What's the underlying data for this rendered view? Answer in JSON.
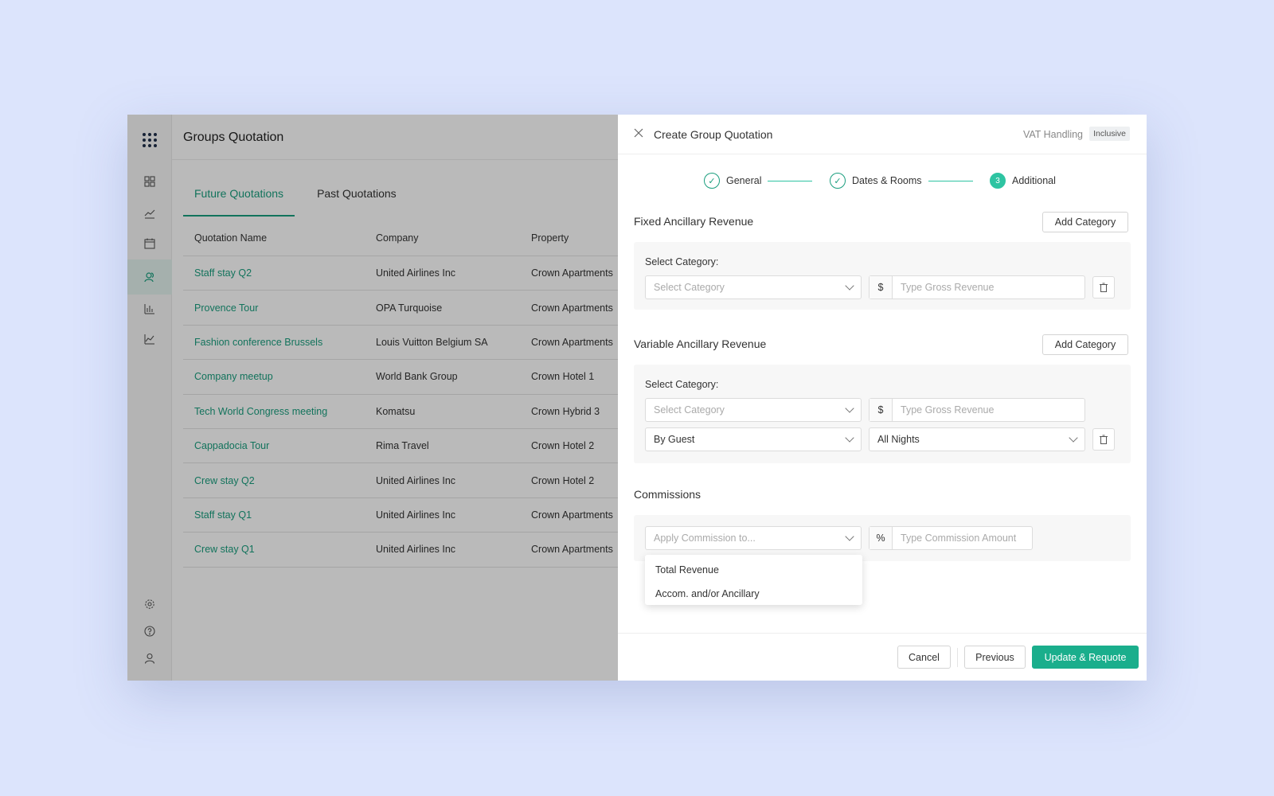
{
  "app": {
    "title": "Groups Quotation"
  },
  "tabs": [
    {
      "label": "Future Quotations",
      "active": true
    },
    {
      "label": "Past Quotations",
      "active": false
    }
  ],
  "table": {
    "headers": [
      "Quotation Name",
      "Company",
      "Property"
    ],
    "rows": [
      [
        "Staff stay Q2",
        "United Airlines Inc",
        "Crown Apartments"
      ],
      [
        "Provence Tour",
        "OPA Turquoise",
        "Crown Apartments"
      ],
      [
        "Fashion conference Brussels",
        "Louis Vuitton Belgium SA",
        "Crown Apartments"
      ],
      [
        "Company meetup",
        "World Bank Group",
        "Crown Hotel 1"
      ],
      [
        "Tech World Congress meeting",
        "Komatsu",
        "Crown Hybrid 3"
      ],
      [
        "Cappadocia Tour",
        "Rima Travel",
        "Crown Hotel 2"
      ],
      [
        "Crew stay Q2",
        "United Airlines Inc",
        "Crown Hotel 2"
      ],
      [
        "Staff stay Q1",
        "United Airlines Inc",
        "Crown Apartments"
      ],
      [
        "Crew stay Q1",
        "United Airlines Inc",
        "Crown Apartments"
      ]
    ]
  },
  "sidebar": {
    "icons": [
      "dashboard-icon",
      "trend-icon",
      "calendar-icon",
      "groups-icon",
      "bar-chart-icon",
      "line-chart-icon"
    ],
    "bottom_icons": [
      "settings-icon",
      "help-icon",
      "user-icon"
    ],
    "active_index": 3
  },
  "modal": {
    "title": "Create Group Quotation",
    "vat_label": "VAT Handling",
    "vat_value": "Inclusive",
    "steps": [
      {
        "label": "General",
        "state": "done"
      },
      {
        "label": "Dates & Rooms",
        "state": "done"
      },
      {
        "label": "Additional",
        "state": "current",
        "number": "3"
      }
    ],
    "fixed": {
      "title": "Fixed Ancillary Revenue",
      "add_label": "Add Category",
      "select_label": "Select Category:",
      "category_placeholder": "Select Category",
      "currency": "$",
      "revenue_placeholder": "Type Gross Revenue"
    },
    "variable": {
      "title": "Variable Ancillary Revenue",
      "add_label": "Add Category",
      "select_label": "Select Category:",
      "category_placeholder": "Select Category",
      "currency": "$",
      "revenue_placeholder": "Type Gross Revenue",
      "by_value": "By Guest",
      "nights_value": "All Nights"
    },
    "commissions": {
      "title": "Commissions",
      "apply_placeholder": "Apply Commission to...",
      "percent": "%",
      "amount_placeholder": "Type Commission Amount",
      "options": [
        "Total Revenue",
        "Accom. and/or Ancillary"
      ]
    },
    "footer": {
      "cancel": "Cancel",
      "previous": "Previous",
      "submit": "Update & Requote"
    }
  },
  "colors": {
    "accent": "#1a9e7e",
    "primary_button": "#1aae8c",
    "background": "#dce4fc"
  }
}
